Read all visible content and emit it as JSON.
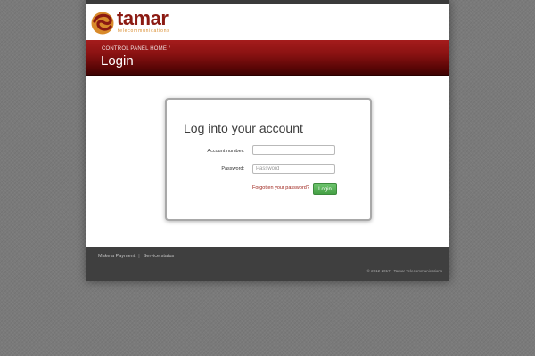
{
  "brand": {
    "name": "tamar",
    "tagline": "telecommunications",
    "colors": {
      "primary": "#8b1a12",
      "accent": "#d88a2a"
    }
  },
  "banner": {
    "breadcrumb_link": "CONTROL PANEL HOME",
    "breadcrumb_separator": "/",
    "title": "Login"
  },
  "login": {
    "heading": "Log into your account",
    "account_label": "Account number:",
    "account_value": "",
    "password_label": "Password:",
    "password_placeholder": "Password",
    "forgot_link": "Forgotten your password?",
    "submit_label": "Login",
    "submit_color": "#45a045"
  },
  "footer": {
    "links": [
      "Make a Payment",
      "Service status"
    ],
    "separator": "|",
    "copyright": "© 2012-2017 · Tamar Telecommunications"
  }
}
